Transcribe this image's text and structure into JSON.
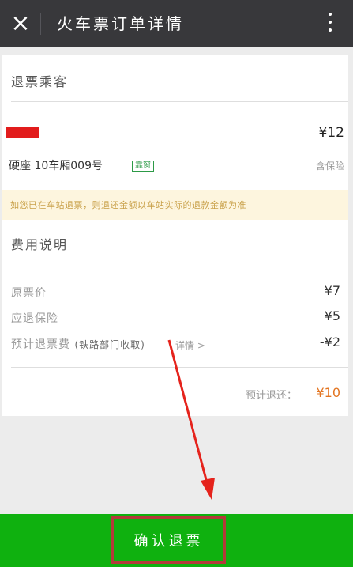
{
  "header": {
    "title": "火车票订单详情",
    "close_icon": "×"
  },
  "passenger": {
    "section_title": "退票乘客",
    "price": "¥12",
    "seat": "硬座 10车厢009号",
    "badge": "靠窗",
    "insurance": "含保险"
  },
  "notice": {
    "text": "如您已在车站退票，则退还金额以车站实际的退款金额为准"
  },
  "fees": {
    "section_title": "费用说明",
    "original_label": "原票价",
    "original_value": "¥7",
    "insurance_label": "应退保险",
    "insurance_value": "¥5",
    "refund_fee_label": "预计退票费",
    "refund_fee_note": "(铁路部门收取)",
    "details_link": "详情 >",
    "refund_fee_value": "-¥2"
  },
  "total": {
    "label": "预计退还：",
    "value": "¥10"
  },
  "footer": {
    "confirm_label": "确认退票"
  },
  "colors": {
    "header_bg": "#38383b",
    "accent_green": "#0fb10f",
    "total_orange": "#e37521",
    "highlight_red": "#e21c1c"
  }
}
